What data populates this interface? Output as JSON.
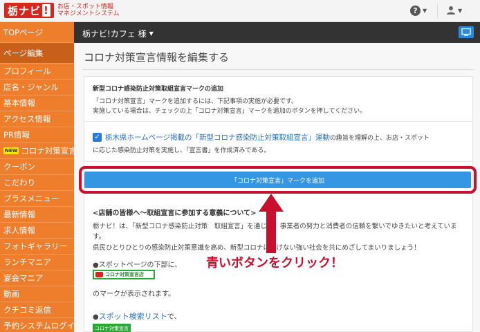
{
  "topbar": {
    "logo_main": "栃ナビ",
    "logo_exclaim": "!",
    "logo_line1": "お店・スポット情報",
    "logo_line2": "マネジメントシステム",
    "help_icon": "question-circle-icon",
    "user_icon": "user-icon"
  },
  "sidebar": {
    "items": [
      {
        "label": "TOPページ",
        "active": false
      },
      {
        "label": "ページ編集",
        "active": true
      },
      {
        "label": "プロフィール"
      },
      {
        "label": "店名・ジャンル"
      },
      {
        "label": "基本情報"
      },
      {
        "label": "アクセス情報"
      },
      {
        "label": "PR情報"
      },
      {
        "label": "コロナ対策宣言",
        "badge": "NEW"
      },
      {
        "label": "クーポン"
      },
      {
        "label": "こだわり"
      },
      {
        "label": "プラスメニュー"
      },
      {
        "label": "最新情報"
      },
      {
        "label": "求人情報"
      },
      {
        "label": "フォトギャラリー"
      },
      {
        "label": "ランチマニア"
      },
      {
        "label": "宴会マニア"
      },
      {
        "label": "動画"
      },
      {
        "label": "クチコミ返信"
      },
      {
        "label": "予約システムログイン"
      }
    ]
  },
  "header": {
    "store_name": "栃ナビ!カフェ 様",
    "monitor_icon": "monitor-icon"
  },
  "main": {
    "page_title": "コロナ対策宣言情報を編集する",
    "section1": {
      "title": "新型コロナ感染防止対策取組宣言マークの追加",
      "line1": "「コロナ対策宣言」マークを追加するには、下記事項の実施が必要です。",
      "line2": "実施している場合は、チェックの上「コロナ対策宣言」マークを追加のボタンを押してください。"
    },
    "checkbox": {
      "checked": true,
      "link_text": "栃木県ホームページ掲載の「新型コロナ感染防止対策取組宣言」運動",
      "text_after_link": "の趣旨を理解の上、お店・スポット",
      "line2": "に応じた感染防止対策を実施し、「宣言書」を作成済みである。"
    },
    "add_button_label": "「コロナ対策宣言」マークを追加",
    "section2": {
      "title": "<店舗の皆様へ〜取組宣言に参加する意義について>",
      "line1": "栃ナビ！は、「新型コロナ感染防止対策　取組宣言」を通じ　、事業者の努力と消費者の信頼を繋いでゆきたいと考えていま",
      "line2": "す。",
      "line3": "県民ひとりひとりの感染防止対策意識を高め、新型コロナに　けない強い社会を共にめざしてまいりましょう！",
      "spot_page_text": "●スポットページの下部に、",
      "spot_badge_label": "コロナ対策宣言店",
      "mark_display_text": "のマークが表示されます。",
      "search_prefix": "●",
      "search_link": "スポット検索リスト",
      "search_suffix": "で、",
      "list_badge_label": "コロナ対策宣言"
    }
  },
  "annotation": {
    "text": "青いボタンをクリック！",
    "color": "#c8102e"
  },
  "colors": {
    "sidebar": "#ee7d2c",
    "sidebar_active": "#c9601a",
    "header": "#333333",
    "button": "#3596e3",
    "brand_red": "#d9261c"
  }
}
